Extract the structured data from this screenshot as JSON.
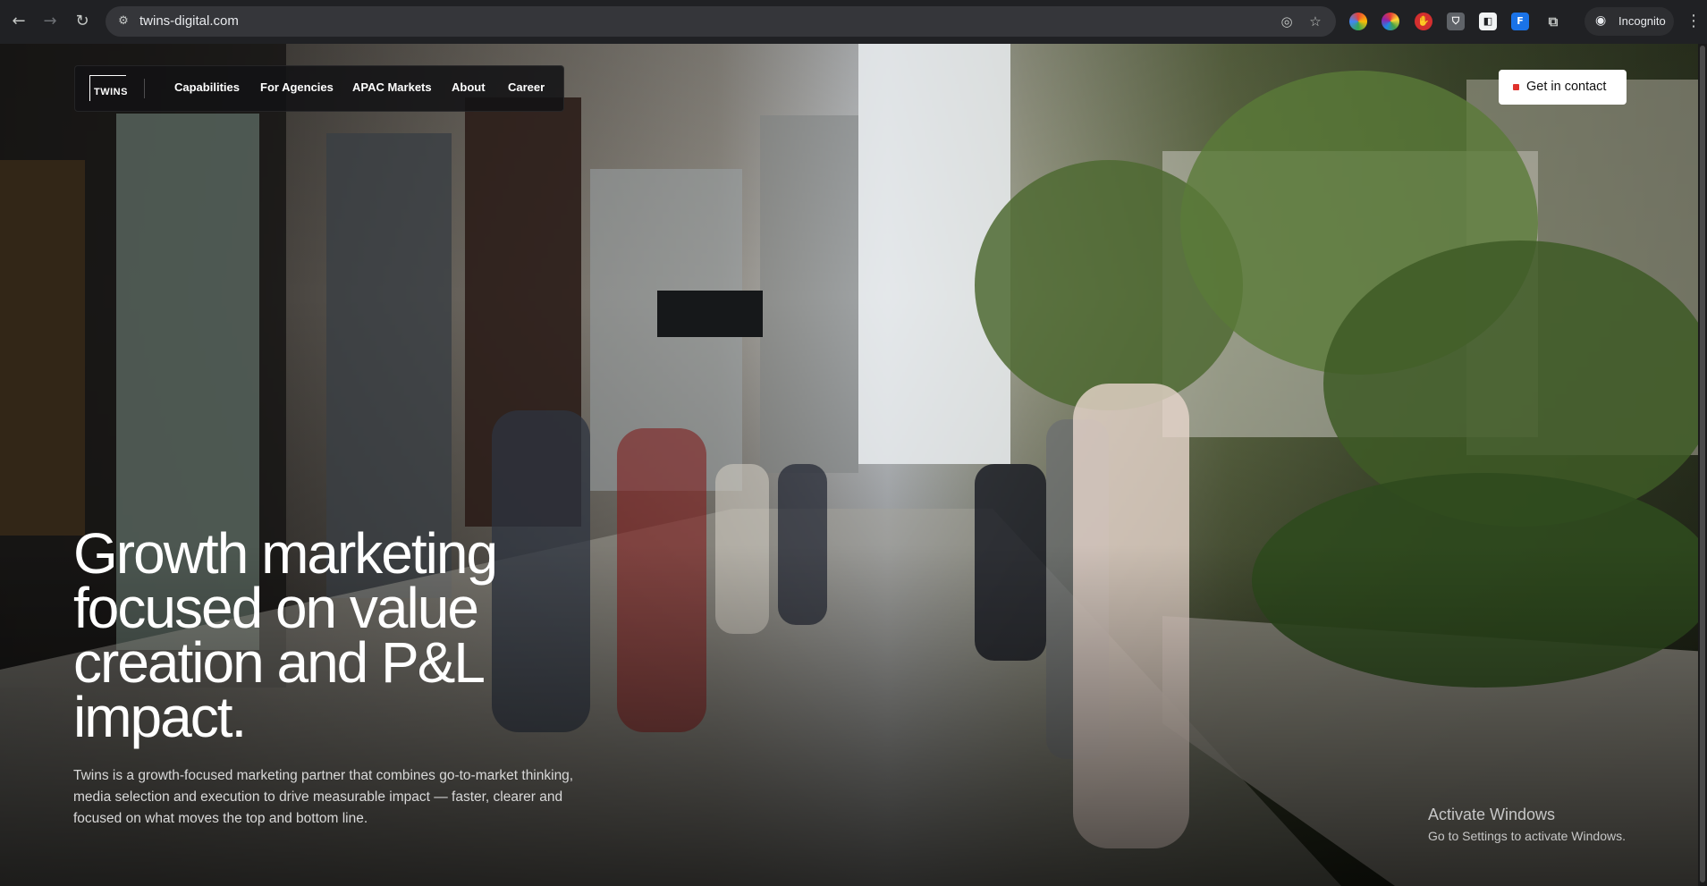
{
  "browser": {
    "url": "twins-digital.com",
    "profile_label": "Incognito",
    "icons": {
      "back": "arrow-left-icon",
      "forward": "arrow-right-icon",
      "reload": "reload-icon",
      "site_info": "tune-icon",
      "eye_off": "eye-off-icon",
      "bookmark": "star-icon",
      "extensions": "puzzle-icon",
      "menu": "kebab-menu-icon"
    }
  },
  "site": {
    "logo_text": "TWINS",
    "nav": [
      {
        "label": "Capabilities"
      },
      {
        "label": "For Agencies"
      },
      {
        "label": "APAC Markets"
      },
      {
        "label": "About"
      },
      {
        "label": "Career"
      }
    ],
    "cta_label": "Get in contact",
    "cta_dot_color": "#e0322d",
    "hero": {
      "title": "Growth marketing focused on value creation and P&L impact.",
      "subtitle": "Twins is a growth-focused marketing partner that combines go-to-market thinking, media selection and execution to drive measurable impact — faster, clearer and focused on what moves the top and bottom line.",
      "background_image": "city street sidewalk with pedestrians, café storefronts and planters"
    }
  },
  "os_overlay": {
    "title": "Activate Windows",
    "subtitle": "Go to Settings to activate Windows."
  }
}
